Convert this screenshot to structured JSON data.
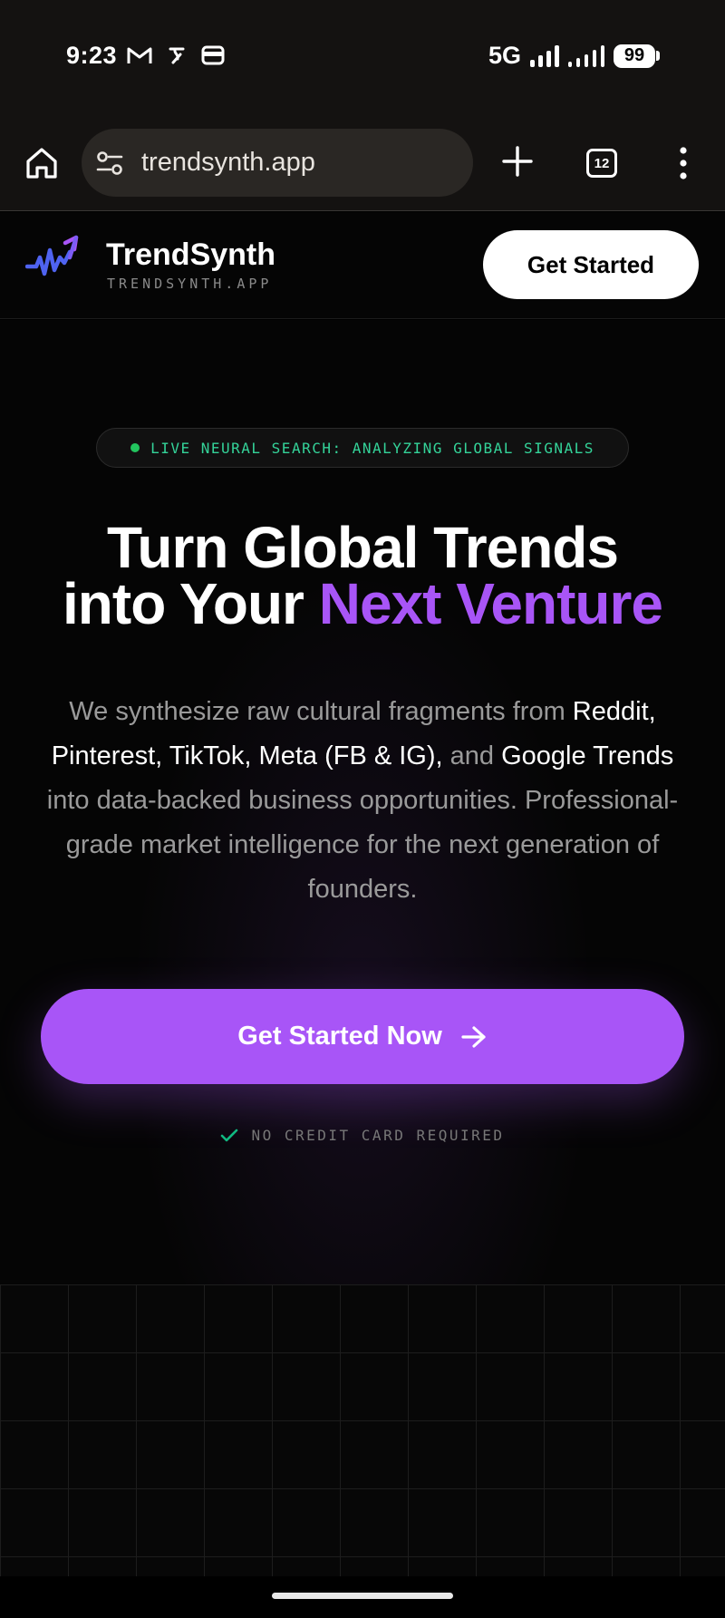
{
  "status_bar": {
    "time": "9:23",
    "network": "5G",
    "battery": "99",
    "left_icons": [
      "gmail-icon",
      "news-icon",
      "wallet-icon"
    ]
  },
  "browser": {
    "url": "trendsynth.app",
    "tab_count": "12"
  },
  "site_header": {
    "brand_name": "TrendSynth",
    "brand_url": "TRENDSYNTH.APP",
    "cta_label": "Get Started"
  },
  "hero": {
    "badge_text": "LIVE NEURAL SEARCH: ANALYZING GLOBAL SIGNALS",
    "headline_line1": "Turn Global Trends",
    "headline_line2_prefix": "into Your ",
    "headline_accent": "Next Venture",
    "sub_part1": "We synthesize raw cultural fragments from ",
    "sub_platforms": "Reddit, Pinterest, TikTok, Meta (FB & IG),",
    "sub_and": " and ",
    "sub_google": "Google Trends",
    "sub_part2": " into data-backed business opportunities. Professional-grade market intelligence for the next generation of founders.",
    "cta_label": "Get Started Now",
    "no_card_text": "NO CREDIT CARD REQUIRED"
  },
  "colors": {
    "accent": "#a855f7",
    "live": "#22c55e",
    "check": "#10b981"
  }
}
